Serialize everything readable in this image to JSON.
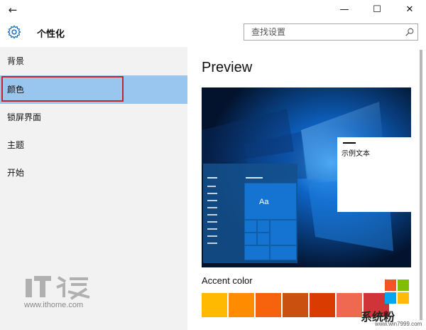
{
  "window": {
    "back_icon": "arrow-left-icon",
    "minimize": "—",
    "maximize": "☐",
    "close": "✕"
  },
  "header": {
    "icon": "gear-icon",
    "title": "个性化",
    "search_placeholder": "查找设置"
  },
  "sidebar": {
    "items": [
      {
        "label": "背景"
      },
      {
        "label": "颜色",
        "selected": true
      },
      {
        "label": "锁屏界面"
      },
      {
        "label": "主题"
      },
      {
        "label": "开始"
      }
    ]
  },
  "main": {
    "preview_title": "Preview",
    "tile_label": "Aa",
    "sample_text": "示例文本",
    "accent_label": "Accent color",
    "accent_colors": [
      "#ffb900",
      "#ff8c00",
      "#f7630c",
      "#ca5010",
      "#da3b01",
      "#ef6950",
      "#d13438"
    ]
  },
  "watermarks": {
    "ithome_url": "www.ithome.com",
    "brand": "系统粉",
    "brand_url": "www.win7999.com"
  }
}
